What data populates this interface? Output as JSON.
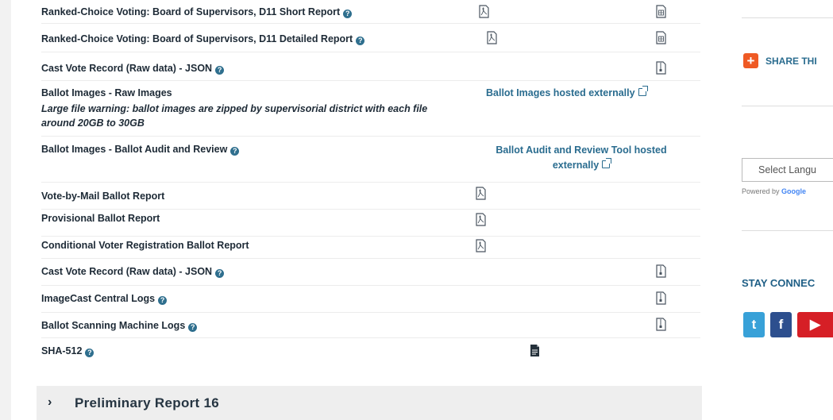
{
  "rows": [
    {
      "label": "Ranked-Choice Voting: Board of Supervisors, D11 Short Report",
      "help": true
    },
    {
      "label": "Ranked-Choice Voting: Board of Supervisors, D11 Detailed Report",
      "help": true
    },
    {
      "label": "Cast Vote Record (Raw data) - JSON",
      "help": true
    },
    {
      "label": "Ballot Images - Raw Images",
      "help": false,
      "note": "Large file warning: ballot images are zipped by supervisorial district with each file around 20GB to 30GB",
      "link": "Ballot Images hosted externally"
    },
    {
      "label": "Ballot Images - Ballot Audit and Review",
      "help": true,
      "link": "Ballot Audit and Review Tool hosted externally"
    },
    {
      "label": "Vote-by-Mail Ballot Report",
      "help": false
    },
    {
      "label": "Provisional Ballot Report",
      "help": false
    },
    {
      "label": "Conditional Voter Registration Ballot Report",
      "help": false
    },
    {
      "label": "Cast Vote Record (Raw data) - JSON",
      "help": true
    },
    {
      "label": "ImageCast Central Logs",
      "help": true
    },
    {
      "label": "Ballot Scanning Machine Logs",
      "help": true
    },
    {
      "label": "SHA-512",
      "help": true
    }
  ],
  "accordion": {
    "title": "Preliminary Report 16",
    "chevron": "›"
  },
  "sidebar": {
    "share": "SHARE THI",
    "language_select": "Select Langu",
    "powered_by": "Powered by",
    "google": "Google",
    "stay_connected": "STAY CONNEC",
    "social": {
      "twitter": "t",
      "facebook": "f",
      "youtube": "▶"
    }
  },
  "icons": [
    "pdf-icon",
    "spreadsheet-icon",
    "zip-icon",
    "file-solid-icon",
    "external-link-icon",
    "question-icon",
    "plus-icon"
  ],
  "colors": {
    "link": "#2a6c8f",
    "accent": "#ef5a24",
    "heading": "#1f5f86"
  }
}
